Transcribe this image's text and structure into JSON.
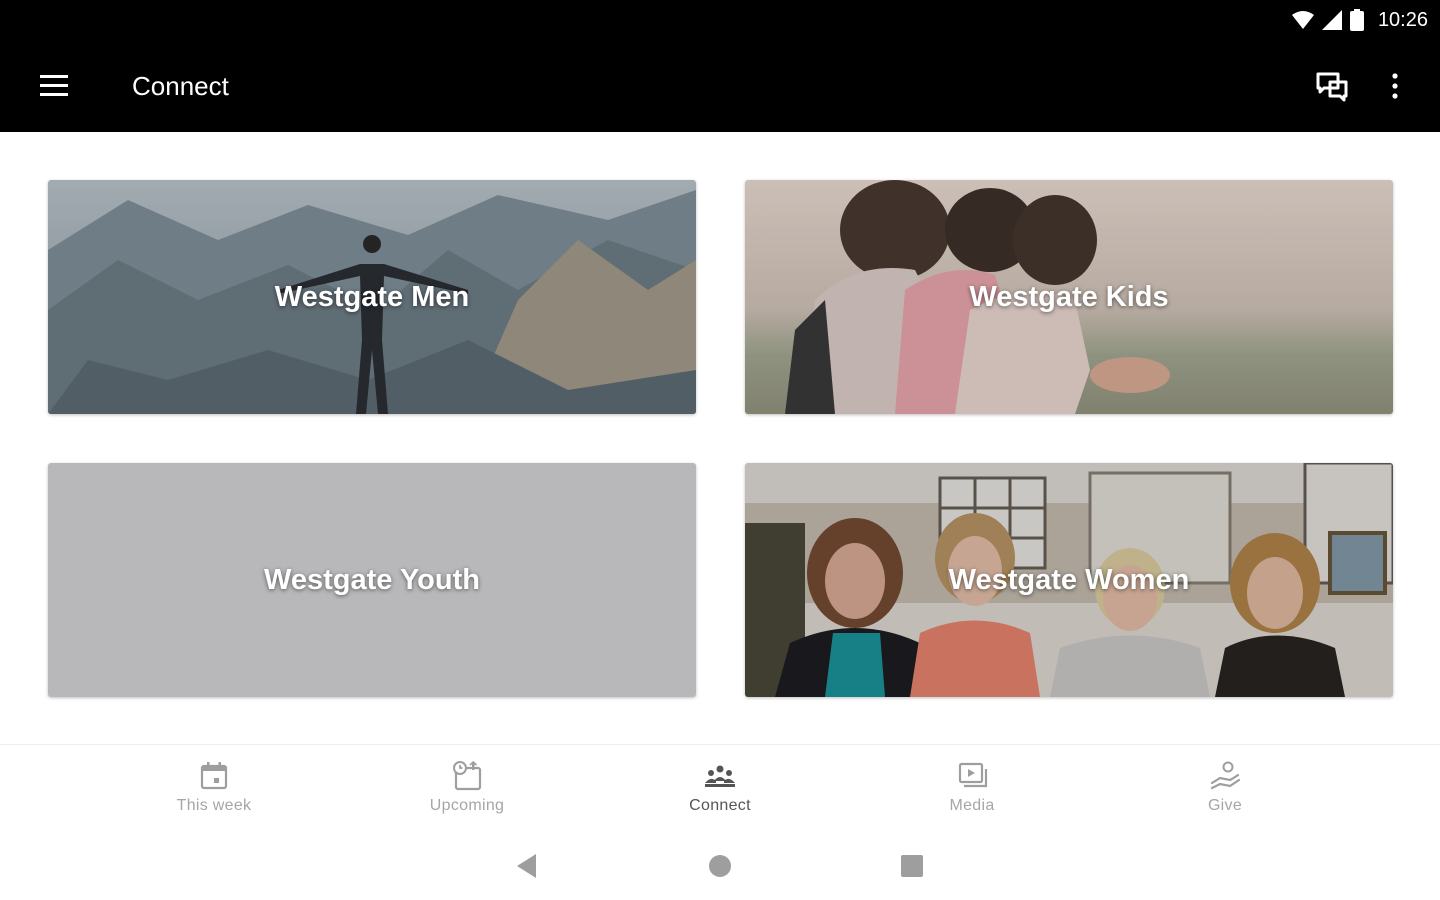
{
  "status": {
    "time": "10:26"
  },
  "app_bar": {
    "title": "Connect"
  },
  "cards": [
    {
      "label": "Westgate Men"
    },
    {
      "label": "Westgate Kids"
    },
    {
      "label": "Westgate Youth"
    },
    {
      "label": "Westgate Women"
    }
  ],
  "bottom_nav": [
    {
      "label": "This week",
      "icon": "calendar-icon"
    },
    {
      "label": "Upcoming",
      "icon": "upcoming-calendar-icon"
    },
    {
      "label": "Connect",
      "icon": "people-group-icon"
    },
    {
      "label": "Media",
      "icon": "media-icon"
    },
    {
      "label": "Give",
      "icon": "give-hand-icon"
    }
  ],
  "active_tab": "Connect",
  "colors": {
    "app_bar": "#000000",
    "youth_card": "#b8b8ba",
    "nav_inactive": "#a6a6a6",
    "nav_active": "#555555"
  }
}
